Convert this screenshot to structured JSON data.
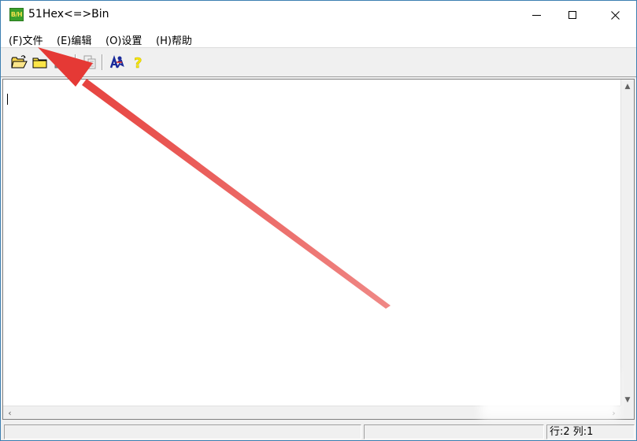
{
  "window": {
    "title": "51Hex<=>Bin",
    "icon_label": "B/H",
    "icon_color": "#3aa02c"
  },
  "menu": {
    "items": [
      {
        "label": "(F)文件"
      },
      {
        "label": "(E)编辑"
      },
      {
        "label": "(O)设置"
      },
      {
        "label": "(H)帮助"
      }
    ]
  },
  "toolbar": {
    "buttons": [
      {
        "icon": "open-folder-icon"
      },
      {
        "icon": "new-folder-icon"
      },
      {
        "icon": "save-icon"
      },
      {
        "icon": "copy-icon"
      },
      {
        "icon": "convert-run-icon"
      },
      {
        "icon": "help-question-icon"
      }
    ],
    "help_glyph": "?"
  },
  "editor": {
    "content": ""
  },
  "statusbar": {
    "panel1": "",
    "panel2": "",
    "position": "行:2  列:1"
  },
  "annotation": {
    "color": "#e53935"
  }
}
